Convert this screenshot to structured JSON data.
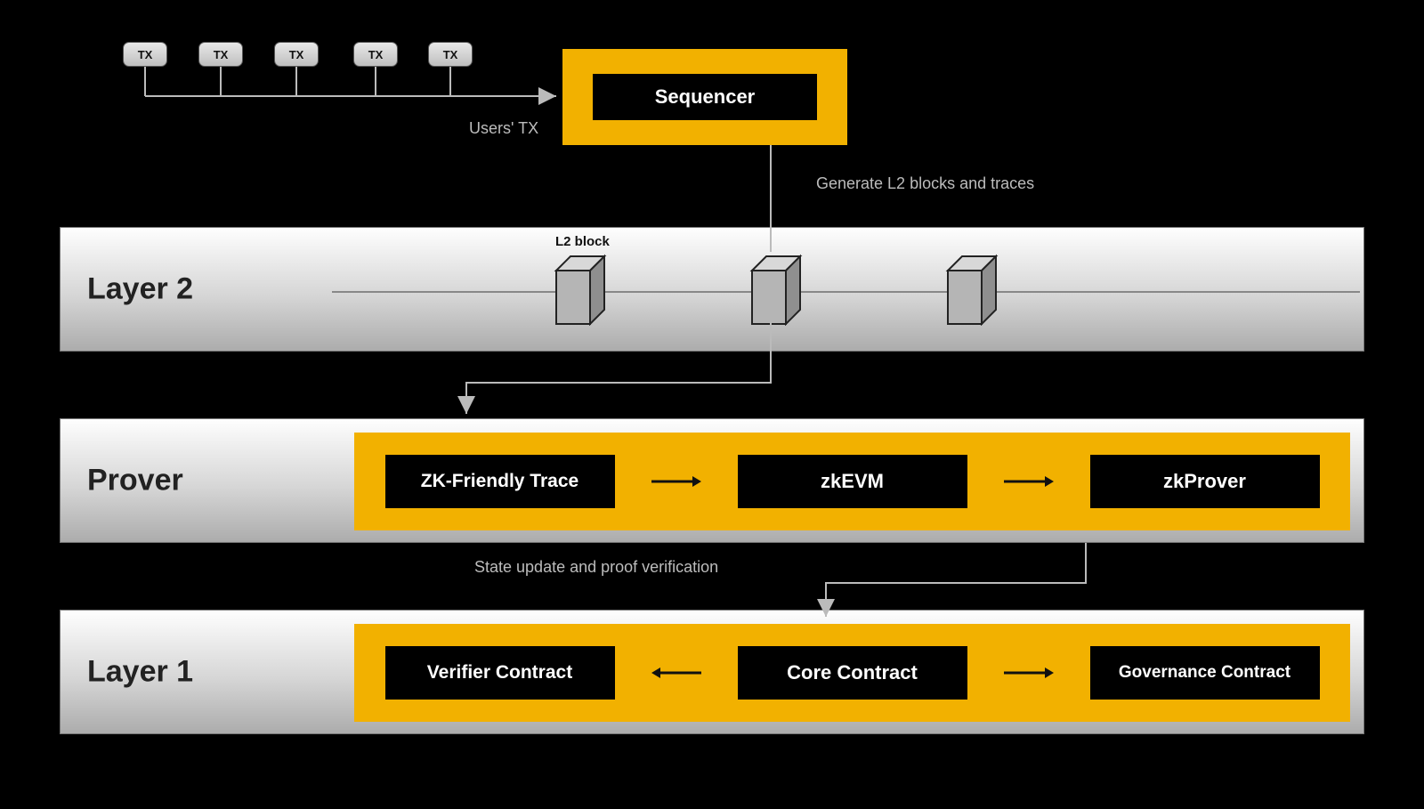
{
  "tx": {
    "label": "TX",
    "count": 5
  },
  "sequencer": {
    "label": "Sequencer"
  },
  "captions": {
    "users_tx": "Users' TX",
    "gen_blocks": "Generate L2 blocks and traces",
    "state_update": "State update and proof verification",
    "l2_block": "L2 block"
  },
  "layers": {
    "layer2": {
      "label": "Layer 2"
    },
    "prover": {
      "label": "Prover",
      "boxes": {
        "trace": "ZK-Friendly Trace",
        "zkevm": "zkEVM",
        "zkprover": "zkProver"
      }
    },
    "layer1": {
      "label": "Layer 1",
      "boxes": {
        "verifier": "Verifier Contract",
        "core": "Core Contract",
        "gov": "Governance Contract"
      }
    }
  },
  "colors": {
    "accent": "#f2b100",
    "bg": "#000000"
  }
}
